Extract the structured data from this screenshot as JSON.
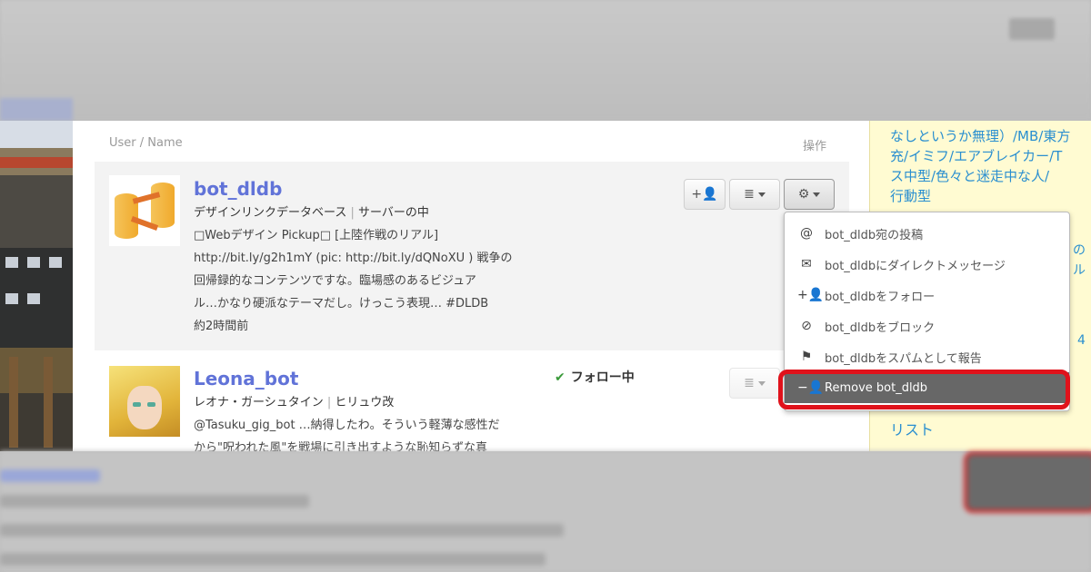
{
  "table": {
    "header_user": "User / Name",
    "header_ops": "操作"
  },
  "rows": [
    {
      "username": "bot_dldb",
      "display_name": "デザインリンクデータベース",
      "subtitle": "サーバーの中",
      "tweet_lines": [
        "□Webデザイン Pickup□ [上陸作戦のリアル]",
        "http://bit.ly/g2h1mY (pic: http://bit.ly/dQNoXU ) 戦争の",
        "回帰録的なコンテンツですな。臨場感のあるビジュア",
        "ル…かなり硬派なテーマだし。けっこう表現… #DLDB",
        "約2時間前"
      ]
    },
    {
      "username": "Leona_bot",
      "display_name": "レオナ・ガーシュタイン",
      "subtitle": "ヒリュウ改",
      "status": "フォロー中",
      "tweet_lines": [
        "@Tasuku_gig_bot …納得したわ。そういう軽薄な感性だ",
        "から\"呪われた風\"を戦場に引き出すような恥知らずな真"
      ]
    }
  ],
  "menu": {
    "items": [
      {
        "icon": "at-icon",
        "glyph": "@",
        "label": "bot_dldb宛の投稿"
      },
      {
        "icon": "envelope-icon",
        "glyph": "✉",
        "label": "bot_dldbにダイレクトメッセージ"
      },
      {
        "icon": "follow-icon",
        "glyph": "+👤",
        "label": "bot_dldbをフォロー"
      },
      {
        "icon": "block-icon",
        "glyph": "⊘",
        "label": "bot_dldbをブロック"
      },
      {
        "icon": "spam-icon",
        "glyph": "⚑",
        "label": "bot_dldbをスパムとして報告"
      },
      {
        "icon": "remove-user-icon",
        "glyph": "−👤",
        "label": "Remove bot_dldb"
      }
    ]
  },
  "sidebar": {
    "lines": [
      "なしというか無理）/MB/東方",
      "充/イミフ/エアブレイカー/T",
      "ス中型/色々と迷走中な人/",
      "行動型"
    ],
    "fragment_1": "の",
    "fragment_2": "ル",
    "fragment_3": "4",
    "link": "リスト"
  },
  "colors": {
    "username": "#6173d8",
    "link": "#2a8fd0",
    "highlight": "#e0121b",
    "menu_selected": "#676767"
  }
}
